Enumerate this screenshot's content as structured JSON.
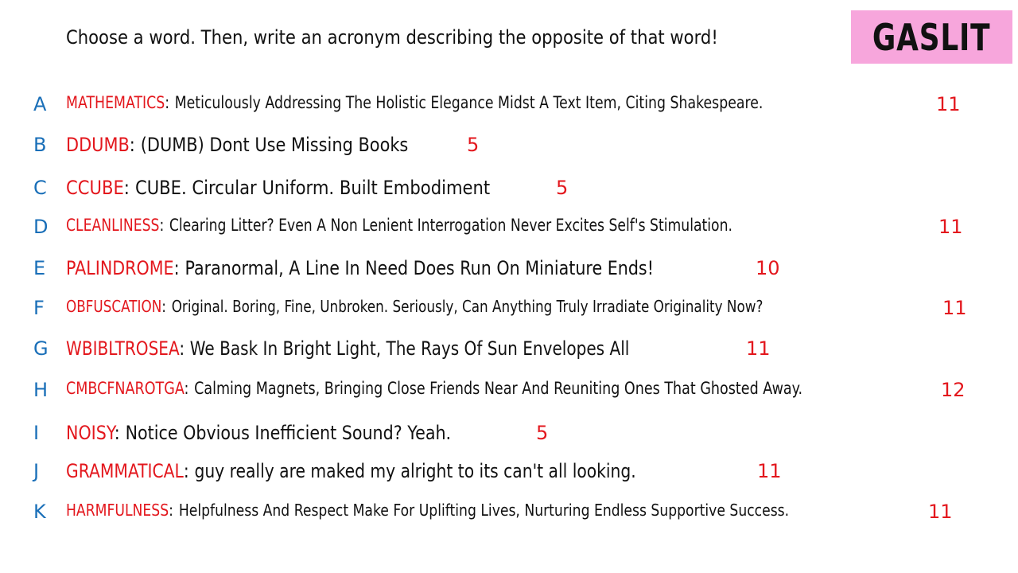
{
  "header": {
    "prompt": "Choose a word. Then, write an acronym describing the opposite of that word!",
    "brand": "GASLIT"
  },
  "colors": {
    "brand_background": "#f7a6dc",
    "word_red": "#e3171d",
    "letter_blue": "#1a6fb8",
    "text": "#111111"
  },
  "rows": [
    {
      "letter": "A",
      "word": "MATHEMATICS",
      "colon": ":",
      "acronym": "Meticulously Addressing The Holistic Elegance Midst A Text Item, Citing Shakespeare.",
      "score": "11"
    },
    {
      "letter": "B",
      "word": "DDUMB",
      "colon": ":",
      "acronym": "(DUMB) Dont Use Missing Books",
      "score": "5"
    },
    {
      "letter": "C",
      "word": "CCUBE",
      "colon": ":",
      "acronym": "CUBE. Circular Uniform. Built Embodiment",
      "score": "5"
    },
    {
      "letter": "D",
      "word": "CLEANLINESS",
      "colon": ":",
      "acronym": "Clearing Litter? Even A Non Lenient Interrogation Never Excites Self's Stimulation.",
      "score": "11"
    },
    {
      "letter": "E",
      "word": "PALINDROME",
      "colon": ":",
      "acronym": "Paranormal, A Line In Need Does Run On Miniature Ends!",
      "score": "10"
    },
    {
      "letter": "F",
      "word": "OBFUSCATION",
      "colon": ":",
      "acronym": "Original. Boring, Fine, Unbroken. Seriously, Can Anything Truly Irradiate Originality Now?",
      "score": "11"
    },
    {
      "letter": "G",
      "word": "WBIBLTROSEA",
      "colon": ":",
      "acronym": "We Bask In Bright Light, The Rays Of Sun Envelopes All",
      "score": "11"
    },
    {
      "letter": "H",
      "word": "CMBCFNAROTGA",
      "colon": ":",
      "acronym": "Calming Magnets, Bringing Close Friends Near And Reuniting Ones That Ghosted Away.",
      "score": "12"
    },
    {
      "letter": "I",
      "word": "NOISY",
      "colon": ":",
      "acronym": "Notice Obvious Inefficient Sound? Yeah.",
      "score": "5"
    },
    {
      "letter": "J",
      "word": "GRAMMATICAL",
      "colon": ":",
      "acronym": "guy really are maked my alright to its can't all looking.",
      "score": "11"
    },
    {
      "letter": "K",
      "word": "HARMFULNESS",
      "colon": ":",
      "acronym": "Helpfulness And Respect Make For Uplifting Lives, Nurturing Endless Supportive Success.",
      "score": "11"
    }
  ]
}
